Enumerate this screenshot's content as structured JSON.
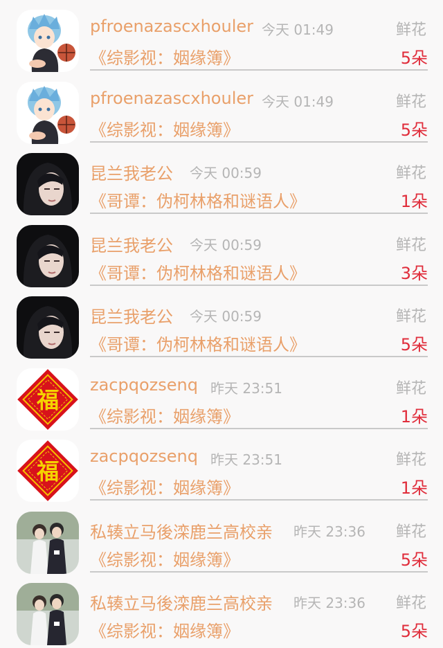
{
  "rows": [
    {
      "avatar": "anime-avatar-icon",
      "name": "pfroenazascxhouler",
      "time": "今天 01:49",
      "gift": "鲜花",
      "book": "《综影视：姻缘簿》",
      "count": "5朵"
    },
    {
      "avatar": "anime-avatar-icon",
      "name": "pfroenazascxhouler",
      "time": "今天 01:49",
      "gift": "鲜花",
      "book": "《综影视：姻缘簿》",
      "count": "5朵"
    },
    {
      "avatar": "portrait-avatar-icon",
      "name": "昆兰我老公",
      "time": "今天 00:59",
      "gift": "鲜花",
      "book": "《哥谭：伪柯林格和谜语人》",
      "count": "1朵"
    },
    {
      "avatar": "portrait-avatar-icon",
      "name": "昆兰我老公",
      "time": "今天 00:59",
      "gift": "鲜花",
      "book": "《哥谭：伪柯林格和谜语人》",
      "count": "3朵"
    },
    {
      "avatar": "portrait-avatar-icon",
      "name": "昆兰我老公",
      "time": "今天 00:59",
      "gift": "鲜花",
      "book": "《哥谭：伪柯林格和谜语人》",
      "count": "5朵"
    },
    {
      "avatar": "fu-avatar-icon",
      "name": "zacpqozsenq",
      "time": "昨天 23:51",
      "gift": "鲜花",
      "book": "《综影视：姻缘簿》",
      "count": "1朵"
    },
    {
      "avatar": "fu-avatar-icon",
      "name": "zacpqozsenq",
      "time": "昨天 23:51",
      "gift": "鲜花",
      "book": "《综影视：姻缘簿》",
      "count": "1朵"
    },
    {
      "avatar": "couple-avatar-icon",
      "name": "私辏立马後滦鹿兰高校亲",
      "time": "昨天 23:36",
      "gift": "鲜花",
      "book": "《综影视：姻缘簿》",
      "count": "5朵"
    },
    {
      "avatar": "couple-avatar-icon",
      "name": "私辏立马後滦鹿兰高校亲",
      "time": "昨天 23:36",
      "gift": "鲜花",
      "book": "《综影视：姻缘簿》",
      "count": "5朵"
    }
  ],
  "fu_char": "福",
  "colors": {
    "name": "#e9a06a",
    "meta": "#b5b5b5",
    "count": "#e02d3b",
    "divider": "#c9c9c9",
    "background": "#f9f8f8"
  }
}
